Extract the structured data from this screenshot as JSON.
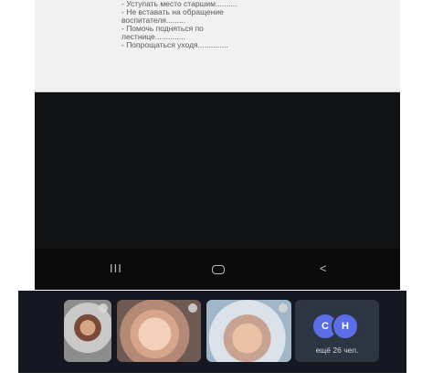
{
  "document": {
    "lines": [
      "- Уступать место старшим..........",
      "- Не вставать на обращение",
      "воспитателя.........",
      "- Помочь подняться по",
      "лестнице..............",
      "- Попрощаться уходя.............."
    ]
  },
  "navigation": {
    "recent_apps_glyph": "III",
    "home_glyph": "",
    "back_glyph": "<"
  },
  "participants": {
    "tiles": [
      {
        "label": "participant-1"
      },
      {
        "label": "participant-2"
      },
      {
        "label": "participant-3"
      }
    ],
    "extra_avatars": [
      "C",
      "H"
    ],
    "more_label": "ещё 26 чел."
  },
  "colors": {
    "avatar_bg": "#5b6ee8",
    "tray_bg": "#151820",
    "doc_bg": "#f1f1f1"
  }
}
